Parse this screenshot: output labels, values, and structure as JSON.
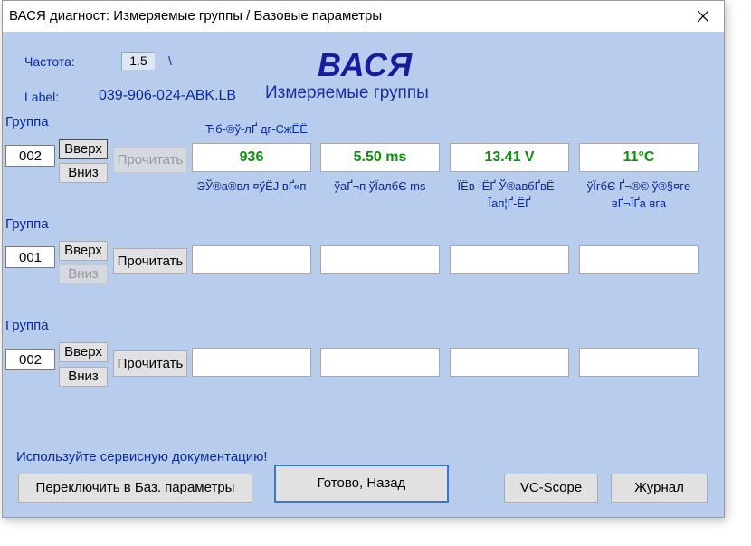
{
  "window": {
    "title": "ВАСЯ диагност: Измеряемые группы / Базовые параметры"
  },
  "header": {
    "freq_label": "Частота:",
    "freq_value": "1.5",
    "freq_indicator": "\\",
    "label_label": "Label:",
    "label_value": "039-906-024-ABK.LB",
    "logo": "ВАСЯ",
    "subtitle": "Измеряемые группы"
  },
  "groups": [
    {
      "group_label": "Группа",
      "group_number": "002",
      "up_label": "Вверх",
      "down_label": "Вниз",
      "read_label": "Прочитать",
      "caption": "Ћб-®ў-лҐ дг-ЄжЁЁ",
      "fields": [
        {
          "value": "936",
          "label": "ЭЎ®а®вл ¤ўЁЈ вҐ«п"
        },
        {
          "value": "5.50 ms",
          "label": "ўаҐ¬п ўЇалбЄ ms"
        },
        {
          "value": "13.41 V",
          "label": "ЇЁв -ЁҐ Ў®авбҐвЁ - Їап¦Ґ-ЁҐ"
        },
        {
          "value": "11°C",
          "label": "ўЇгбЄ Ґ¬®© ў®§¤гe вҐ¬ЇҐа вга"
        }
      ]
    },
    {
      "group_label": "Группа",
      "group_number": "001",
      "up_label": "Вверх",
      "down_label": "Вниз",
      "read_label": "Прочитать",
      "fields": [
        {
          "value": ""
        },
        {
          "value": ""
        },
        {
          "value": ""
        },
        {
          "value": ""
        }
      ]
    },
    {
      "group_label": "Группа",
      "group_number": "002",
      "up_label": "Вверх",
      "down_label": "Вниз",
      "read_label": "Прочитать",
      "fields": [
        {
          "value": ""
        },
        {
          "value": ""
        },
        {
          "value": ""
        },
        {
          "value": ""
        }
      ]
    }
  ],
  "footer": {
    "hint": "Используйте сервисную документацию!",
    "switch_label": "Переключить в Баз. параметры",
    "done_label": "Готово, Назад",
    "vcscope_rest": "C-Scope",
    "vcscope_mnemonic": "V",
    "journal_label": "Журнал"
  },
  "colors": {
    "window_bg": "#b8ccee",
    "value_green": "#0f8f0f",
    "label_blue": "#0a2b9a",
    "logo_blue": "#1a1a9e"
  }
}
